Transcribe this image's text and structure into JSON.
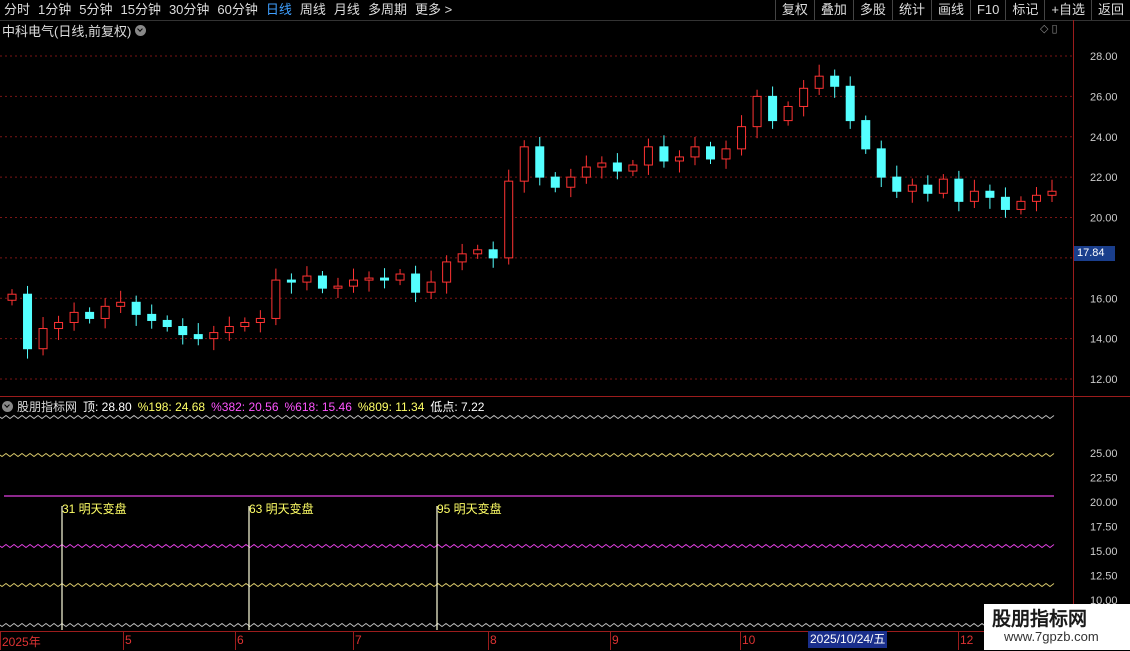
{
  "toolbar": {
    "periods": [
      "分时",
      "1分钟",
      "5分钟",
      "15分钟",
      "30分钟",
      "60分钟",
      "日线",
      "周线",
      "月线",
      "多周期",
      "更多 >"
    ],
    "active_index": 6,
    "right_buttons": [
      "复权",
      "叠加",
      "多股",
      "统计",
      "画线",
      "F10",
      "标记",
      "+自选",
      "返回"
    ]
  },
  "main": {
    "title": "中科电气(日线,前复权)",
    "price_tag": "17.84",
    "y_ticks": [
      "28.00",
      "26.00",
      "24.00",
      "22.00",
      "20.00",
      "16.00",
      "14.00",
      "12.00"
    ]
  },
  "indicator": {
    "name": "股朋指标网",
    "values": [
      {
        "label": "顶: 28.80",
        "color": "#ffffff"
      },
      {
        "label": "%198: 24.68",
        "color": "#ffff66"
      },
      {
        "label": "%382: 20.56",
        "color": "#ff55ff"
      },
      {
        "label": "%618: 15.46",
        "color": "#ff55ff"
      },
      {
        "label": "%809: 11.34",
        "color": "#ffff66"
      },
      {
        "label": "低点: 7.22",
        "color": "#ffffff"
      }
    ],
    "y_ticks": [
      "25.00",
      "22.50",
      "20.00",
      "17.50",
      "15.00",
      "12.50",
      "10.00"
    ],
    "annotations": [
      "31 明天变盘",
      "63 明天变盘",
      "95 明天变盘"
    ]
  },
  "date_axis": {
    "labels": [
      "2025年",
      "5",
      "6",
      "7",
      "8",
      "9",
      "10",
      "12"
    ],
    "cursor": "2025/10/24/五"
  },
  "watermark": {
    "line1": "股朋指标网",
    "line2": "www.7gpzb.com"
  },
  "colors": {
    "up": "#ff3333",
    "down": "#54ffff",
    "grid": "#8b1a1a",
    "accent": "#3fa0ff"
  },
  "chart_data": {
    "type": "candlestick",
    "title": "中科电气(日线,前复权)",
    "ylim": [
      11.5,
      29
    ],
    "series_close_approx": [
      16.2,
      13.5,
      14.5,
      14.8,
      15.3,
      15.0,
      15.6,
      15.8,
      15.2,
      14.9,
      14.6,
      14.2,
      14.0,
      14.3,
      14.6,
      14.8,
      15.0,
      16.9,
      16.8,
      17.1,
      16.5,
      16.6,
      16.9,
      17.0,
      16.9,
      17.2,
      16.3,
      16.8,
      17.8,
      18.2,
      18.4,
      18.0,
      21.8,
      23.5,
      22.0,
      21.5,
      22.0,
      22.5,
      22.7,
      22.3,
      22.6,
      23.5,
      22.8,
      23.0,
      23.5,
      22.9,
      23.4,
      24.5,
      26.0,
      24.8,
      25.5,
      26.4,
      27.0,
      26.5,
      24.8,
      23.4,
      22.0,
      21.3,
      21.6,
      21.2,
      21.9,
      20.8,
      21.3,
      21.0,
      20.4,
      20.8,
      21.1,
      21.3
    ]
  }
}
